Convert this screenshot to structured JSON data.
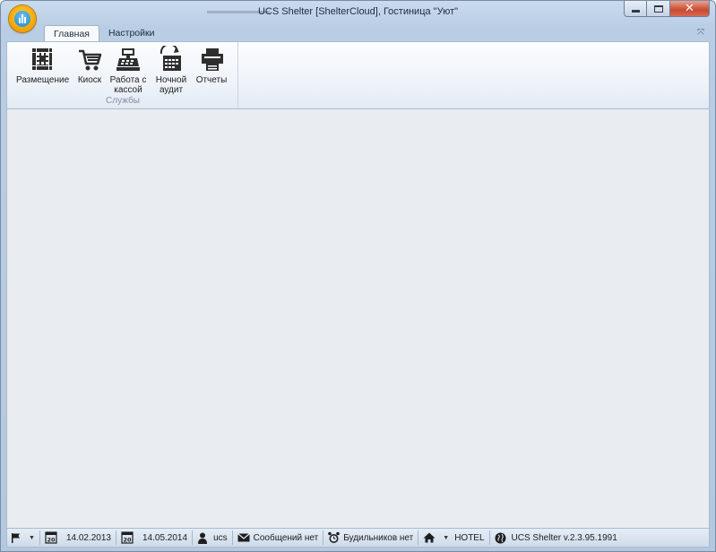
{
  "window": {
    "title": "UCS Shelter [ShelterCloud], Гостиница \"Уют\"",
    "app_icon": "ucs-shelter-logo"
  },
  "ribbon": {
    "tabs": [
      {
        "label": "Главная",
        "active": true
      },
      {
        "label": "Настройки",
        "active": false
      }
    ],
    "group": {
      "label": "Службы",
      "buttons": [
        {
          "label": "Размещение",
          "icon": "grid-icon"
        },
        {
          "label": "Киоск",
          "icon": "cart-icon"
        },
        {
          "label": "Работа с кассой",
          "icon": "cash-register-icon"
        },
        {
          "label": "Ночной аудит",
          "icon": "calendar-refresh-icon"
        },
        {
          "label": "Отчеты",
          "icon": "printer-icon"
        }
      ]
    }
  },
  "statusbar": {
    "date1": "14.02.2013",
    "date2": "14.05.2014",
    "calendar_day": "20",
    "user": "ucs",
    "messages": "Сообщений нет",
    "alarms": "Будильников нет",
    "hotel": "HOTEL",
    "version": "UCS Shelter v.2.3.95.1991"
  }
}
